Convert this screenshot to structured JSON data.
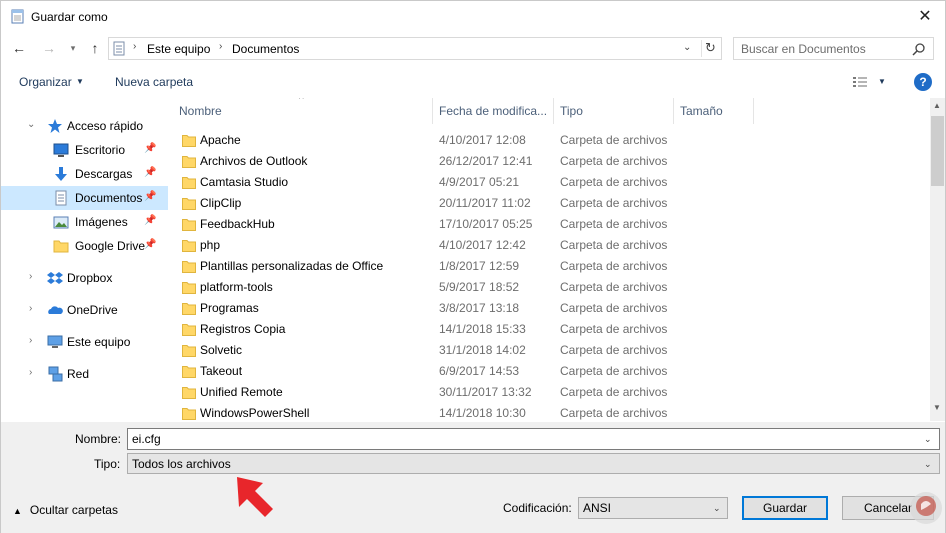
{
  "window": {
    "title": "Guardar como"
  },
  "address": {
    "crumbs": [
      "Este equipo",
      "Documentos"
    ],
    "search_placeholder": "Buscar en Documentos"
  },
  "toolbar": {
    "organize_label": "Organizar",
    "new_folder_label": "Nueva carpeta",
    "help_label": "?"
  },
  "nav": {
    "items": [
      {
        "label": "Acceso rápido",
        "icon": "star-icon",
        "pinned": false
      },
      {
        "label": "Escritorio",
        "icon": "desktop-icon",
        "pinned": true
      },
      {
        "label": "Descargas",
        "icon": "download-icon",
        "pinned": true
      },
      {
        "label": "Documentos",
        "icon": "document-icon",
        "pinned": true,
        "selected": true
      },
      {
        "label": "Imágenes",
        "icon": "pictures-icon",
        "pinned": true
      },
      {
        "label": "Google Drive",
        "icon": "folder-icon",
        "pinned": true
      },
      {
        "label": "Dropbox",
        "icon": "dropbox-icon",
        "pinned": false
      },
      {
        "label": "OneDrive",
        "icon": "onedrive-icon",
        "pinned": false
      },
      {
        "label": "Este equipo",
        "icon": "computer-icon",
        "pinned": false
      },
      {
        "label": "Red",
        "icon": "network-icon",
        "pinned": false
      }
    ]
  },
  "columns": {
    "name": "Nombre",
    "date": "Fecha de modifica...",
    "type": "Tipo",
    "size": "Tamaño"
  },
  "files": [
    {
      "name": "Apache",
      "date": "4/10/2017 12:08",
      "type": "Carpeta de archivos"
    },
    {
      "name": "Archivos de Outlook",
      "date": "26/12/2017 12:41",
      "type": "Carpeta de archivos"
    },
    {
      "name": "Camtasia Studio",
      "date": "4/9/2017 05:21",
      "type": "Carpeta de archivos"
    },
    {
      "name": "ClipClip",
      "date": "20/11/2017 11:02",
      "type": "Carpeta de archivos"
    },
    {
      "name": "FeedbackHub",
      "date": "17/10/2017 05:25",
      "type": "Carpeta de archivos"
    },
    {
      "name": "php",
      "date": "4/10/2017 12:42",
      "type": "Carpeta de archivos"
    },
    {
      "name": "Plantillas personalizadas de Office",
      "date": "1/8/2017 12:59",
      "type": "Carpeta de archivos"
    },
    {
      "name": "platform-tools",
      "date": "5/9/2017 18:52",
      "type": "Carpeta de archivos"
    },
    {
      "name": "Programas",
      "date": "3/8/2017 13:18",
      "type": "Carpeta de archivos"
    },
    {
      "name": "Registros Copia",
      "date": "14/1/2018 15:33",
      "type": "Carpeta de archivos"
    },
    {
      "name": "Solvetic",
      "date": "31/1/2018 14:02",
      "type": "Carpeta de archivos"
    },
    {
      "name": "Takeout",
      "date": "6/9/2017 14:53",
      "type": "Carpeta de archivos"
    },
    {
      "name": "Unified Remote",
      "date": "30/11/2017 13:32",
      "type": "Carpeta de archivos"
    },
    {
      "name": "WindowsPowerShell",
      "date": "14/1/2018 10:30",
      "type": "Carpeta de archivos"
    }
  ],
  "form": {
    "filename_label": "Nombre:",
    "filename_value": "ei.cfg",
    "filetype_label": "Tipo:",
    "filetype_value": "Todos los archivos",
    "encoding_label": "Codificación:",
    "encoding_value": "ANSI"
  },
  "footer": {
    "hide_folders_label": "Ocultar carpetas",
    "save_label": "Guardar",
    "cancel_label": "Cancelar"
  },
  "colors": {
    "accent": "#0078d7",
    "selection": "#cce8ff",
    "folder": "#ffd767",
    "annotation_arrow": "#e8262b"
  }
}
